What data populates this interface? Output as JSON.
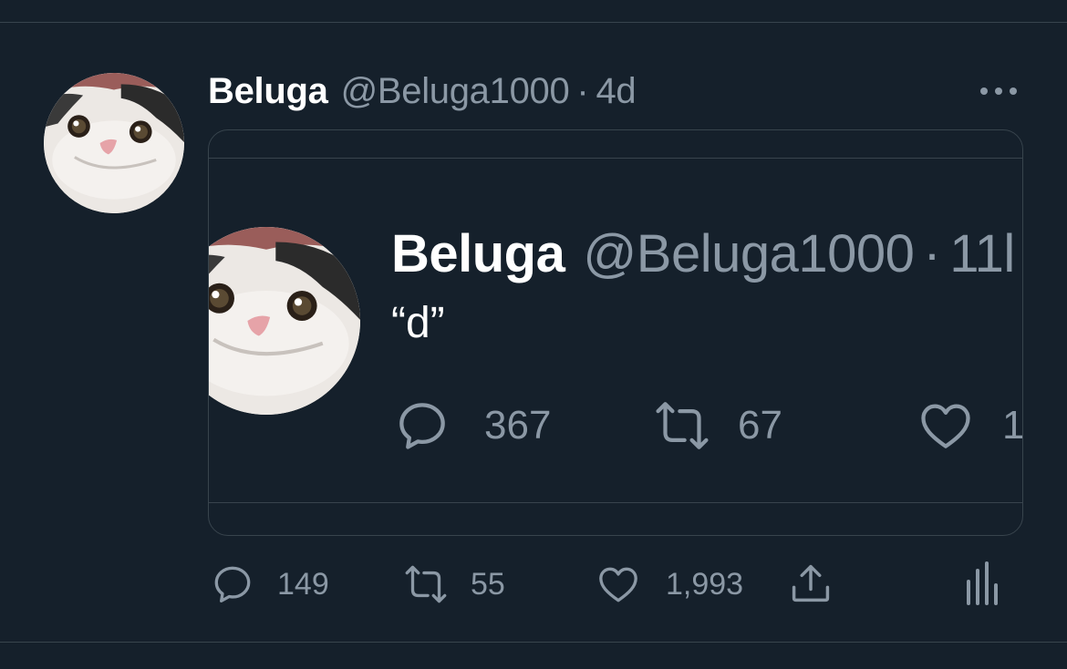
{
  "tweet": {
    "author_name": "Beluga",
    "handle": "@Beluga1000",
    "separator": "·",
    "time": "4d",
    "avatar_icon": "cat-avatar-icon",
    "more_icon": "more-options-icon",
    "actions": {
      "replies": "149",
      "retweets": "55",
      "likes": "1,993"
    }
  },
  "quoted_tweet": {
    "author_name": "Beluga",
    "handle": "@Beluga1000",
    "separator": "·",
    "time": "11l",
    "text": "“d”",
    "actions": {
      "replies": "367",
      "retweets": "67",
      "likes": "1"
    }
  },
  "colors": {
    "background": "#15202b",
    "border": "#38444d",
    "primary_text": "#ffffff",
    "secondary_text": "#8b98a5"
  }
}
